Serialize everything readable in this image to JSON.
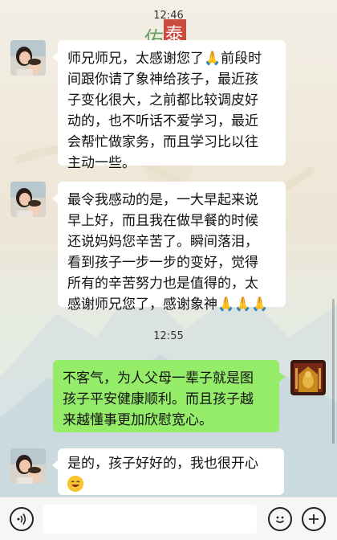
{
  "chat": {
    "time1": "12:46",
    "time2": "12:55",
    "messages": [
      {
        "side": "left",
        "lines": [
          "师兄师兄，太感谢您了🙏前段时",
          "间跟你请了象神给孩子，最近孩",
          "子变化很大，之前都比较调皮好",
          "动的，也不听话不爱学习，最近",
          "会帮忙做家务，而且学习比以往",
          "主动一些。"
        ]
      },
      {
        "side": "left",
        "lines": [
          "最令我感动的是，一大早起来说",
          "早上好，而且我在做早餐的时候",
          "还说妈妈您辛苦了。瞬间落泪，",
          "看到孩子一步一步的变好，觉得",
          "所有的辛苦努力也是值得的，太",
          "感谢师兄您了，感谢象神🙏🙏🙏"
        ]
      },
      {
        "side": "right",
        "lines": [
          "不客气，为人父母一辈子就是图",
          "孩子平安健康顺利。而且孩子越",
          "来越懂事更加欣慰宽心。"
        ]
      },
      {
        "side": "left",
        "lines": [
          "是的，孩子好好的，我也很开心"
        ]
      }
    ]
  },
  "background": {
    "watermark_chars": [
      "佑",
      "泰"
    ]
  },
  "icons": {
    "voice": "voice-icon",
    "emoji": "emoji-icon",
    "plus": "plus-icon",
    "laugh": "laughing-emoji-icon",
    "pray": "pray-emoji-icon"
  },
  "colors": {
    "bubble_left": "#ffffff",
    "bubble_right": "#95ec69",
    "bottom_bar": "#f6f6f6"
  }
}
